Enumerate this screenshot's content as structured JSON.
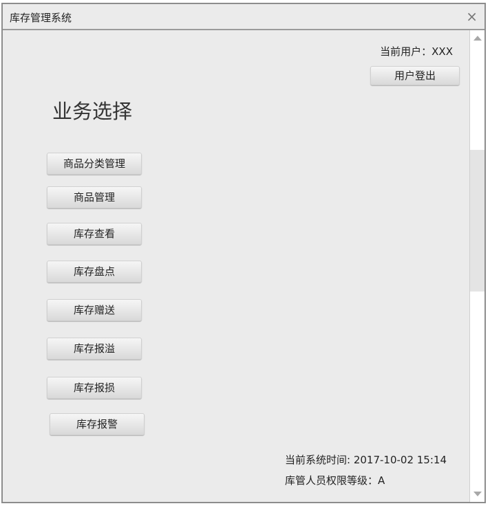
{
  "window": {
    "title": "库存管理系统",
    "close_glyph": "×"
  },
  "user": {
    "current_user_label": "当前用户：XXX",
    "logout_label": "用户登出"
  },
  "main": {
    "heading": "业务选择",
    "menu": [
      {
        "label": "商品分类管理"
      },
      {
        "label": "商品管理"
      },
      {
        "label": "库存查看"
      },
      {
        "label": "库存盘点"
      },
      {
        "label": "库存赠送"
      },
      {
        "label": "库存报溢"
      },
      {
        "label": "库存报损"
      },
      {
        "label": "库存报警"
      }
    ]
  },
  "status": {
    "system_time": "当前系统时间: 2017-10-02 15:14",
    "permission_level": "库管人员权限等级：A"
  },
  "colors": {
    "background": "#ebebeb",
    "border": "#8c8c8c"
  }
}
